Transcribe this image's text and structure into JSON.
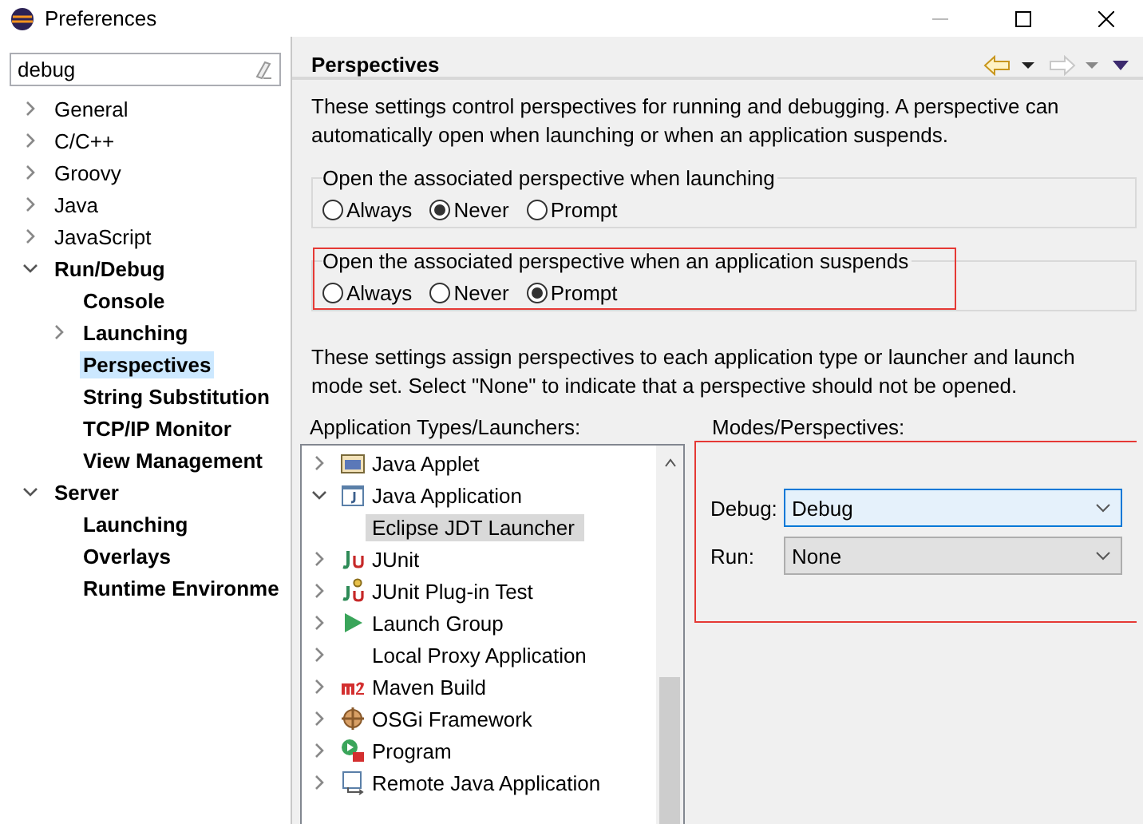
{
  "window": {
    "title": "Preferences"
  },
  "search": {
    "value": "debug"
  },
  "tree": [
    {
      "label": "General",
      "matched": false,
      "expanded": false,
      "selected": false
    },
    {
      "label": "C/C++",
      "matched": false,
      "expanded": false,
      "selected": false
    },
    {
      "label": "Groovy",
      "matched": false,
      "expanded": false,
      "selected": false
    },
    {
      "label": "Java",
      "matched": false,
      "expanded": false,
      "selected": false
    },
    {
      "label": "JavaScript",
      "matched": false,
      "expanded": false,
      "selected": false
    },
    {
      "label": "Run/Debug",
      "matched": true,
      "expanded": true,
      "selected": false,
      "children": [
        {
          "label": "Console",
          "matched": true,
          "selected": false
        },
        {
          "label": "Launching",
          "matched": true,
          "expanded": false,
          "selected": false
        },
        {
          "label": "Perspectives",
          "matched": true,
          "selected": true
        },
        {
          "label": "String Substitution",
          "matched": true,
          "selected": false
        },
        {
          "label": "TCP/IP Monitor",
          "matched": true,
          "selected": false
        },
        {
          "label": "View Management",
          "matched": true,
          "selected": false
        }
      ]
    },
    {
      "label": "Server",
      "matched": true,
      "expanded": true,
      "selected": false,
      "children": [
        {
          "label": "Launching",
          "matched": true,
          "selected": false
        },
        {
          "label": "Overlays",
          "matched": true,
          "selected": false
        },
        {
          "label": "Runtime Environme",
          "matched": true,
          "selected": false
        }
      ]
    }
  ],
  "page": {
    "title": "Perspectives",
    "intro": "These settings control perspectives for running and debugging. A perspective can automatically open when launching or when an application suspends.",
    "groups": [
      {
        "legend": "Open the associated perspective when launching",
        "highlighted": false,
        "options": [
          {
            "label": "Always",
            "selected": false
          },
          {
            "label": "Never",
            "selected": true
          },
          {
            "label": "Prompt",
            "selected": false
          }
        ]
      },
      {
        "legend": "Open the associated perspective when an application suspends",
        "highlighted": true,
        "options": [
          {
            "label": "Always",
            "selected": false
          },
          {
            "label": "Never",
            "selected": false
          },
          {
            "label": "Prompt",
            "selected": true
          }
        ]
      }
    ],
    "assign_text": "These settings assign perspectives to each application type or launcher and launch mode set. Select \"None\" to indicate that a perspective should not be opened.",
    "launchers_label": "Application Types/Launchers:",
    "launchers": [
      {
        "label": "Java Applet",
        "kind": "applet",
        "expanded": false,
        "selected": false
      },
      {
        "label": "Java Application",
        "kind": "app",
        "expanded": true,
        "selected": false,
        "children": [
          {
            "label": "Eclipse JDT Launcher",
            "selected": true
          }
        ]
      },
      {
        "label": "JUnit",
        "kind": "junit",
        "expanded": false,
        "selected": false
      },
      {
        "label": "JUnit Plug-in Test",
        "kind": "plugin",
        "expanded": false,
        "selected": false
      },
      {
        "label": "Launch Group",
        "kind": "group",
        "expanded": false,
        "selected": false
      },
      {
        "label": "Local Proxy Application",
        "kind": "none",
        "expanded": false,
        "selected": false
      },
      {
        "label": "Maven Build",
        "kind": "maven",
        "expanded": false,
        "selected": false
      },
      {
        "label": "OSGi Framework",
        "kind": "osgi",
        "expanded": false,
        "selected": false
      },
      {
        "label": "Program",
        "kind": "program",
        "expanded": false,
        "selected": false
      },
      {
        "label": "Remote Java Application",
        "kind": "remote",
        "expanded": false,
        "selected": false
      }
    ],
    "modes_label": "Modes/Perspectives:",
    "modes_highlighted": true,
    "modes": [
      {
        "label": "Debug:",
        "value": "Debug",
        "focused": true
      },
      {
        "label": "Run:",
        "value": "None",
        "focused": false
      }
    ]
  }
}
